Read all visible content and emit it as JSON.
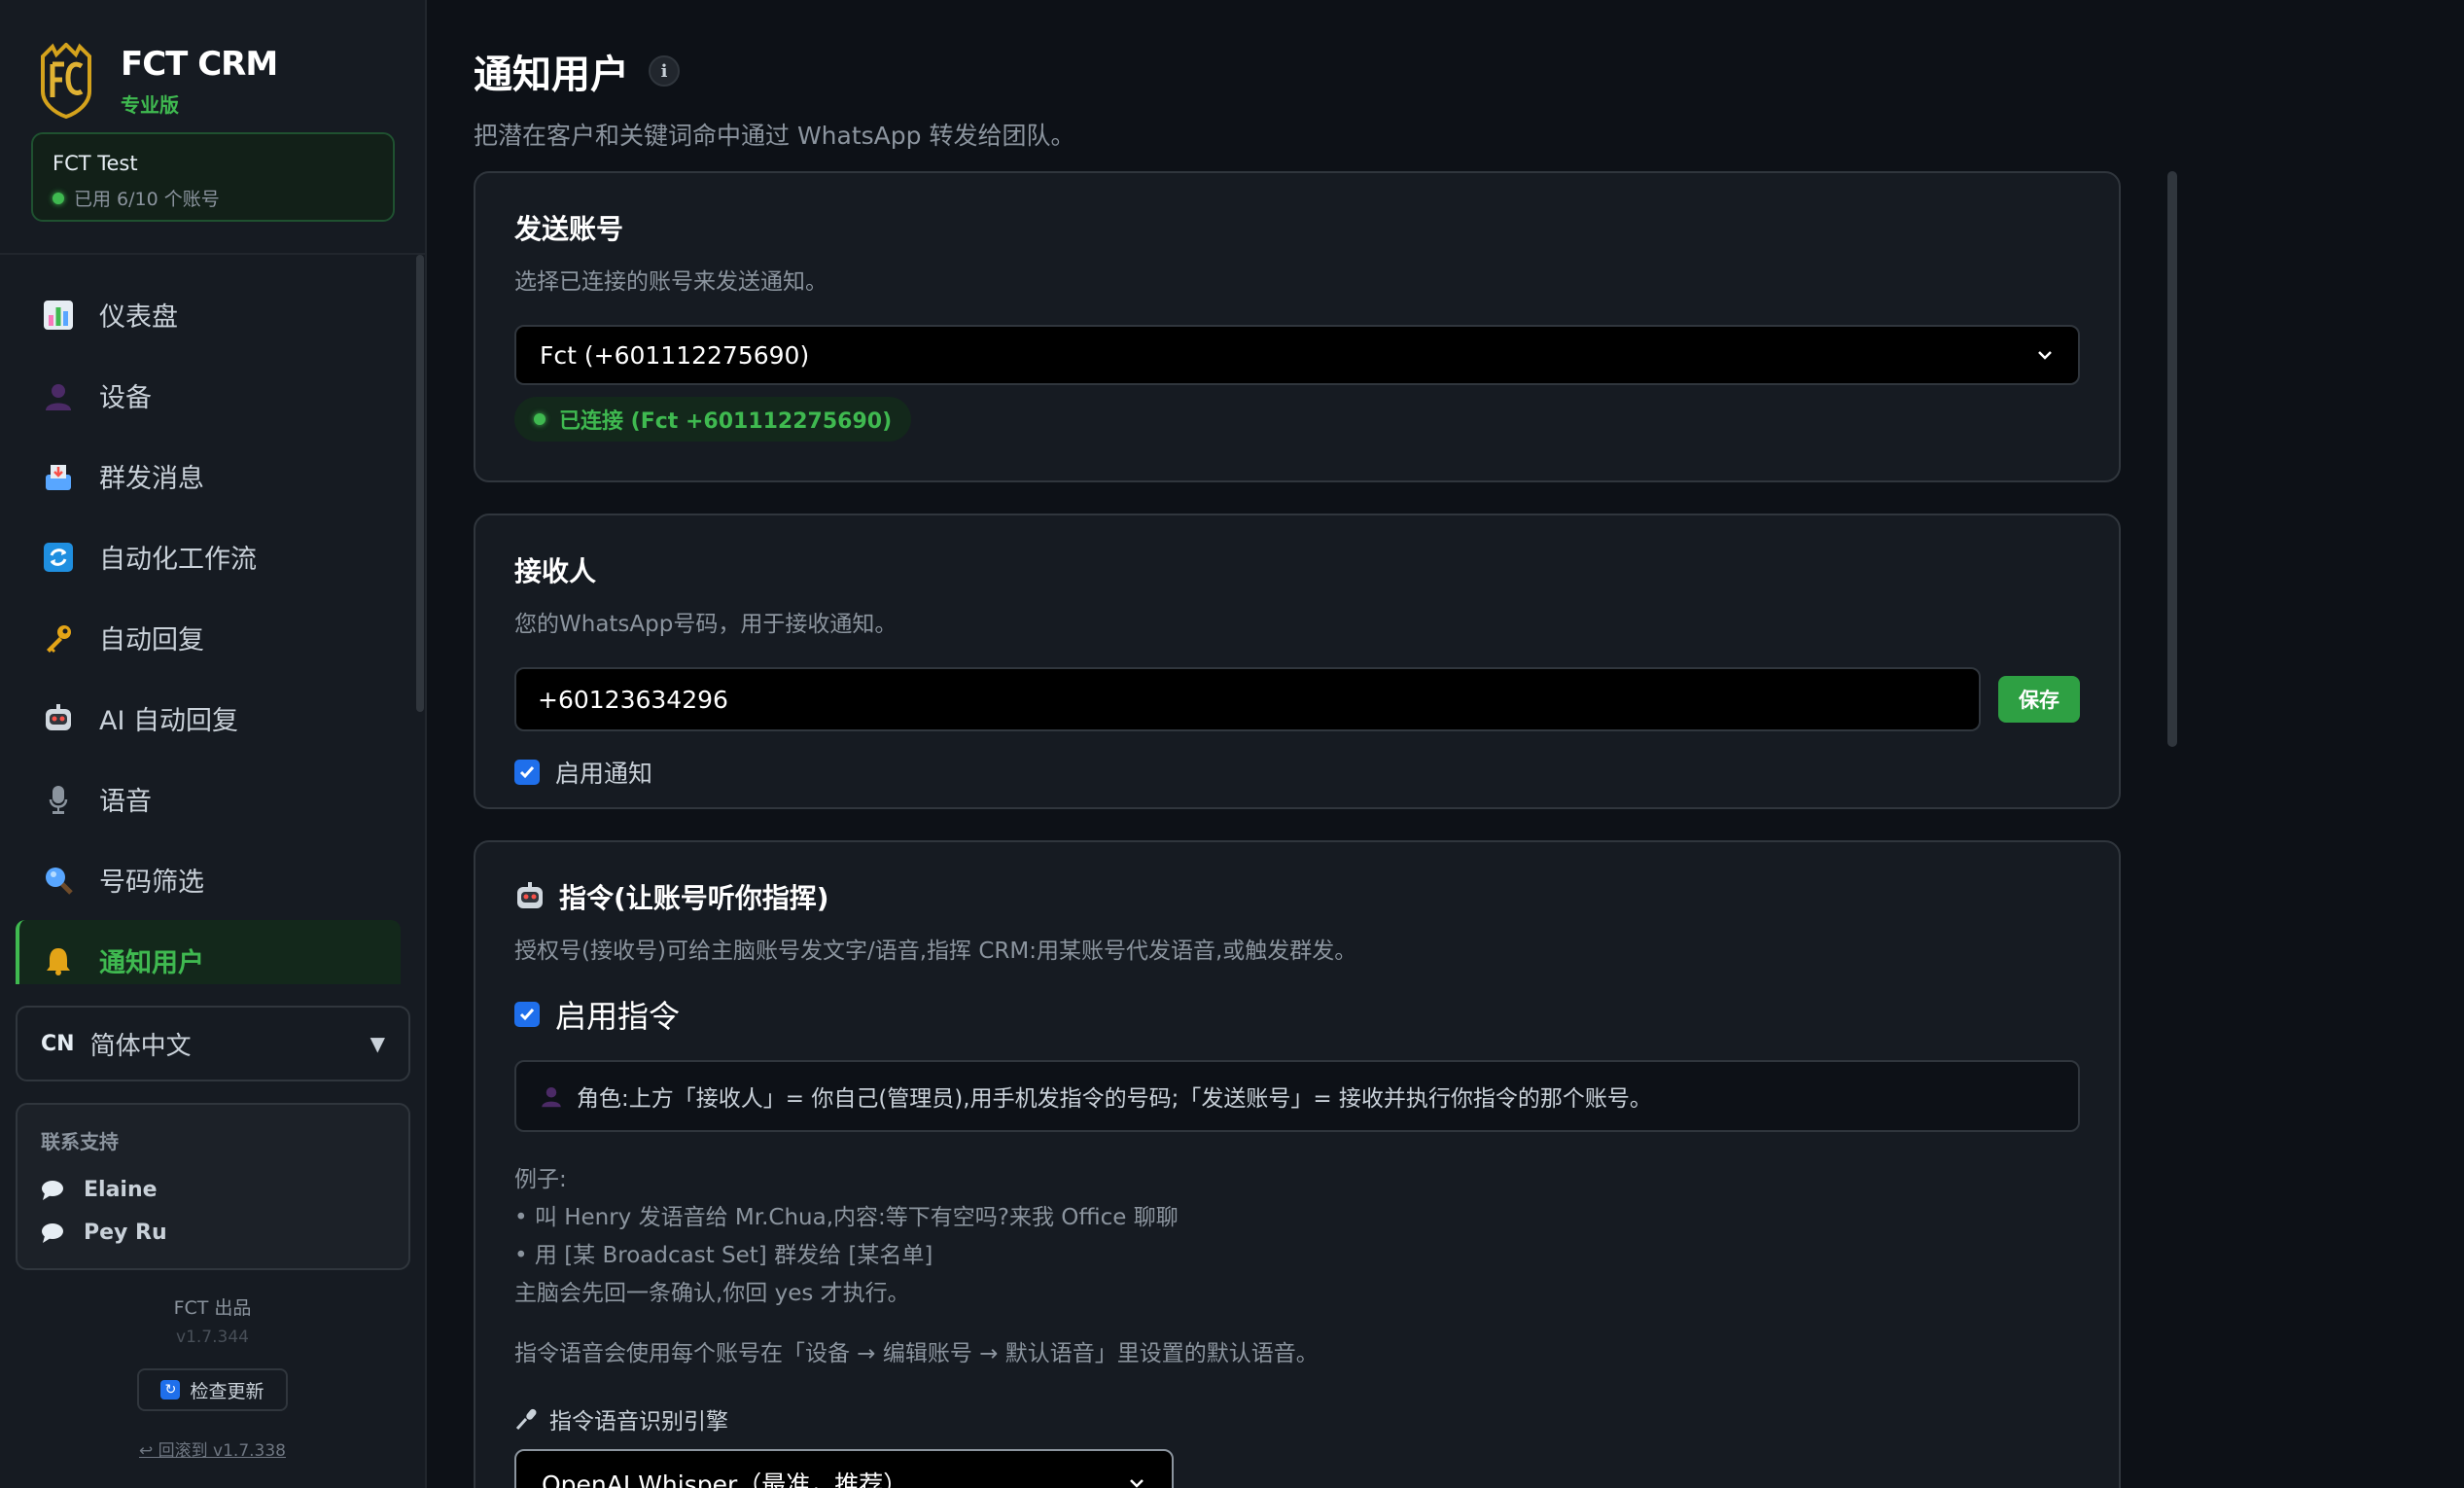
{
  "brand": {
    "name": "FCT CRM",
    "tier": "专业版"
  },
  "account": {
    "name": "FCT Test",
    "usage": "已用 6/10 个账号"
  },
  "nav": {
    "items": [
      {
        "label": "仪表盘",
        "icon": "bar-chart-icon"
      },
      {
        "label": "设备",
        "icon": "person-icon"
      },
      {
        "label": "群发消息",
        "icon": "inbox-tray-icon"
      },
      {
        "label": "自动化工作流",
        "icon": "refresh-icon"
      },
      {
        "label": "自动回复",
        "icon": "key-icon"
      },
      {
        "label": "AI 自动回复",
        "icon": "robot-icon"
      },
      {
        "label": "语音",
        "icon": "microphone-icon"
      },
      {
        "label": "号码筛选",
        "icon": "magnifier-icon"
      },
      {
        "label": "通知用户",
        "icon": "bell-icon"
      }
    ],
    "active_index": 8
  },
  "language": {
    "code": "CN",
    "label": "简体中文",
    "caret": "▼"
  },
  "support": {
    "title": "联系支持",
    "contacts": [
      "Elaine",
      "Pey Ru"
    ]
  },
  "footer": {
    "by": "FCT 出品",
    "version": "v1.7.344",
    "check_update": "检查更新",
    "rollback": "↩ 回滚到 v1.7.338"
  },
  "page": {
    "title": "通知用户",
    "info_glyph": "i",
    "subtitle": "把潜在客户和关键词命中通过 WhatsApp 转发给团队。"
  },
  "sender": {
    "title": "发送账号",
    "desc": "选择已连接的账号来发送通知。",
    "selected": "Fct (+601112275690)",
    "status": "已连接 (Fct +601112275690)"
  },
  "recipient": {
    "title": "接收人",
    "desc": "您的WhatsApp号码，用于接收通知。",
    "phone": "+60123634296",
    "save_label": "保存",
    "enable_label": "启用通知",
    "enabled": true
  },
  "command": {
    "title": "指令(让账号听你指挥)",
    "desc": "授权号(接收号)可给主脑账号发文字/语音,指挥 CRM:用某账号代发语音,或触发群发。",
    "enable_label": "启用指令",
    "enabled": true,
    "role_note": "角色:上方「接收人」= 你自己(管理员),用手机发指令的号码;「发送账号」= 接收并执行你指令的那个账号。",
    "examples": [
      "例子:",
      "• 叫 Henry 发语音给 Mr.Chua,内容:等下有空吗?来我 Office 聊聊",
      "• 用 [某 Broadcast Set] 群发给 [某名单]",
      "主脑会先回一条确认,你回 yes 才执行。"
    ],
    "voice_note": "指令语音会使用每个账号在「设备 → 编辑账号 → 默认语音」里设置的默认语音。",
    "engine_label": "指令语音识别引擎",
    "engine_selected": "OpenAI Whisper（最准，推荐）"
  },
  "colors": {
    "accent": "#3fb950",
    "checkbox": "#1f6feb",
    "background": "#0d1117",
    "card": "#161b22"
  }
}
